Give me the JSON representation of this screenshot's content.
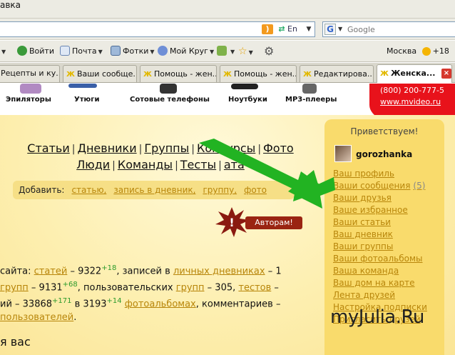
{
  "window": {
    "title": "авка"
  },
  "address_bar": {
    "lang_label": "En"
  },
  "search": {
    "placeholder": "Google"
  },
  "toolbar": {
    "login": "Войти",
    "mail": "Почта",
    "photos": "Фотки",
    "my_circle": "Мой Круг",
    "city": "Москва",
    "temperature": "+18"
  },
  "tabs": [
    {
      "label": "Рецепты и ку...",
      "active": false
    },
    {
      "label": "Ваши сообще...",
      "active": false
    },
    {
      "label": "Помощь - жен...",
      "active": false
    },
    {
      "label": "Помощь - жен...",
      "active": false
    },
    {
      "label": "Редактирова...",
      "active": false
    },
    {
      "label": "Женска...",
      "active": true
    }
  ],
  "categories": [
    {
      "label": "Эпиляторы"
    },
    {
      "label": "Утюги"
    },
    {
      "label": "Сотовые телефоны"
    },
    {
      "label": "Ноутбуки"
    },
    {
      "label": "MP3-плееры"
    }
  ],
  "mvideo": {
    "phone": "(800) 200-777-5",
    "url": "www.mvideo.ru"
  },
  "nav": {
    "row1": [
      "Статьи",
      "Дневники",
      "Группы",
      "Конкурсы",
      "Фото"
    ],
    "row2": [
      "Люди",
      "Команды",
      "Тесты",
      "ата"
    ]
  },
  "add": {
    "label": "Добавить:",
    "links": [
      "статью,",
      "запись в дневник,",
      "группу,",
      "фото"
    ]
  },
  "authors_button": {
    "label": "Авторам!"
  },
  "stats": {
    "line1": {
      "pre": " сайта: ",
      "l1": "статей",
      "t1": " – 9322",
      "s1": "+18",
      "t2": ", записей в ",
      "l2": "личных дневниках",
      "t3": " – 1"
    },
    "line2": {
      "l1": "групп",
      "t1": " – 9131",
      "s1": "+68",
      "t2": ", пользовательских ",
      "l2": "групп",
      "t3": " – 305, ",
      "l3": "тестов",
      "t4": " – "
    },
    "line3": {
      "t1": "ий – 33868",
      "s1": "+171",
      "t2": " в 3193",
      "s2": "+14",
      "t3": " ",
      "l1": "фотоальбомах",
      "t4": ", комментариев – "
    },
    "line4": {
      "l1": "пользователей",
      "t1": "."
    }
  },
  "bottom_heading": "я вас",
  "panel": {
    "greeting": "Приветствуем!",
    "username": "gorozhanka",
    "links": [
      {
        "label": "Ваш профиль"
      },
      {
        "label": "Ваши сообщения",
        "count": "(5)"
      },
      {
        "label": "Ваши друзья"
      },
      {
        "label": "Ваше избранное"
      },
      {
        "label": "Ваши статьи"
      },
      {
        "label": "Ваш дневник"
      },
      {
        "label": "Ваши группы"
      },
      {
        "label": "Ваши фотоальбомы"
      },
      {
        "label": "Ваша команда"
      },
      {
        "label": "Ваш дом на карте"
      },
      {
        "label": "Лента друзей"
      },
      {
        "label": "Настройка подписки"
      },
      {
        "label": "Пригласить друзей"
      }
    ]
  },
  "logo": "myJulia.Ru",
  "colors": {
    "link": "#b8860b",
    "panel": "#f9db6c",
    "arrow": "#22b322",
    "mvideo_red": "#e8121b"
  }
}
